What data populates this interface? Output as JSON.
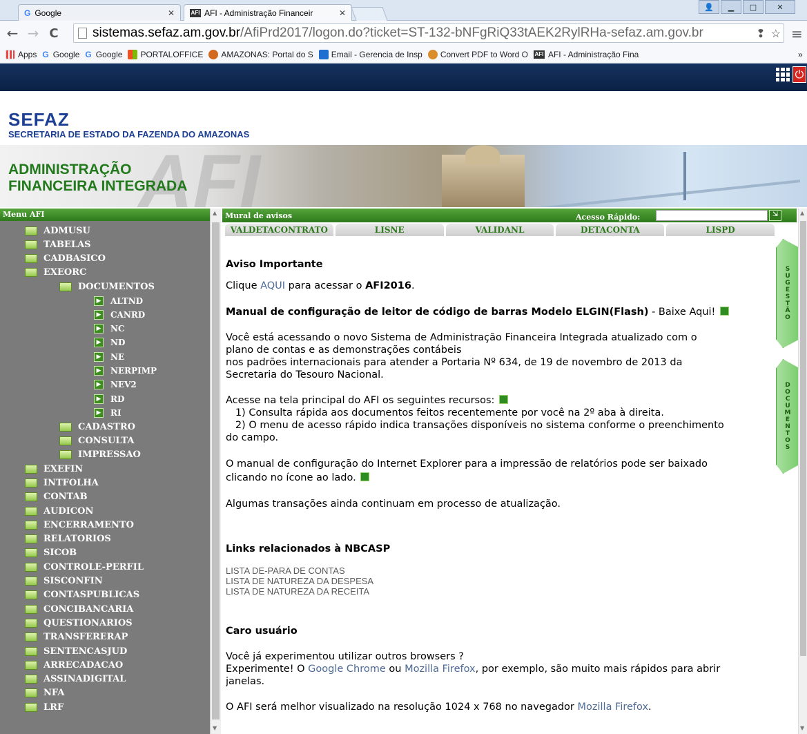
{
  "browser": {
    "tabs": [
      {
        "label": "Google",
        "icon": "google-icon"
      },
      {
        "label": "AFI - Administração Financeir",
        "icon": "afi-icon"
      }
    ],
    "url_host": "sistemas.sefaz.am.gov.br",
    "url_path": "/AfiPrd2017/logon.do?ticket=ST-132-bNFgRiQ33tAEK2RylRHa-sefaz.am.gov.br",
    "bookmarks": [
      "Apps",
      "Google",
      "Google",
      "PORTALOFFICE",
      "AMAZONAS: Portal do S",
      "Email - Gerencia de Insp",
      "Convert PDF to Word O",
      "AFI - Administração Fina"
    ],
    "bookmarks_more": "»"
  },
  "header": {
    "title": "SEFAZ",
    "subtitle": "SECRETARIA DE ESTADO DA FAZENDA DO AMAZONAS",
    "banner_line1": "ADMINISTRAÇÃO",
    "banner_line2": "FINANCEIRA INTEGRADA",
    "banner_watermark": "AFI"
  },
  "menu": {
    "title": "Menu AFI",
    "items": [
      {
        "label": "ADMUSU",
        "level": 0,
        "type": "folder"
      },
      {
        "label": "TABELAS",
        "level": 0,
        "type": "folder"
      },
      {
        "label": "CADBASICO",
        "level": 0,
        "type": "folder"
      },
      {
        "label": "EXEORC",
        "level": 0,
        "type": "folder"
      },
      {
        "label": "DOCUMENTOS",
        "level": 1,
        "type": "folder"
      },
      {
        "label": "ALTND",
        "level": 2,
        "type": "doc"
      },
      {
        "label": "CANRD",
        "level": 2,
        "type": "doc"
      },
      {
        "label": "NC",
        "level": 2,
        "type": "doc"
      },
      {
        "label": "ND",
        "level": 2,
        "type": "doc"
      },
      {
        "label": "NE",
        "level": 2,
        "type": "doc"
      },
      {
        "label": "NERPIMP",
        "level": 2,
        "type": "doc"
      },
      {
        "label": "NEV2",
        "level": 2,
        "type": "doc"
      },
      {
        "label": "RD",
        "level": 2,
        "type": "doc"
      },
      {
        "label": "RI",
        "level": 2,
        "type": "doc"
      },
      {
        "label": "CADASTRO",
        "level": 1,
        "type": "folder"
      },
      {
        "label": "CONSULTA",
        "level": 1,
        "type": "folder"
      },
      {
        "label": "IMPRESSAO",
        "level": 1,
        "type": "folder"
      },
      {
        "label": "EXEFIN",
        "level": 0,
        "type": "folder"
      },
      {
        "label": "INTFOLHA",
        "level": 0,
        "type": "folder"
      },
      {
        "label": "CONTAB",
        "level": 0,
        "type": "folder"
      },
      {
        "label": "AUDICON",
        "level": 0,
        "type": "folder"
      },
      {
        "label": "ENCERRAMENTO",
        "level": 0,
        "type": "folder"
      },
      {
        "label": "RELATORIOS",
        "level": 0,
        "type": "folder"
      },
      {
        "label": "SICOB",
        "level": 0,
        "type": "folder"
      },
      {
        "label": "CONTROLE-PERFIL",
        "level": 0,
        "type": "folder"
      },
      {
        "label": "SISCONFIN",
        "level": 0,
        "type": "folder"
      },
      {
        "label": "CONTASPUBLICAS",
        "level": 0,
        "type": "folder"
      },
      {
        "label": "CONCIBANCARIA",
        "level": 0,
        "type": "folder"
      },
      {
        "label": "QUESTIONARIOS",
        "level": 0,
        "type": "folder"
      },
      {
        "label": "TRANSFERERAP",
        "level": 0,
        "type": "folder"
      },
      {
        "label": "SENTENCASJUD",
        "level": 0,
        "type": "folder"
      },
      {
        "label": "ARRECADACAO",
        "level": 0,
        "type": "folder"
      },
      {
        "label": "ASSINADIGITAL",
        "level": 0,
        "type": "folder"
      },
      {
        "label": "NFA",
        "level": 0,
        "type": "folder"
      },
      {
        "label": "LRF",
        "level": 0,
        "type": "folder"
      }
    ]
  },
  "mural": {
    "title": "Mural de avisos",
    "acesso_label": "Acesso Rápido:",
    "acesso_value": "",
    "quick_tabs": [
      "VALDETACONTRATO",
      "LISNE",
      "VALIDANL",
      "DETACONTA",
      "LISPD"
    ]
  },
  "content": {
    "aviso_title": "Aviso Importante",
    "clique_pre": "Clique ",
    "clique_link": "AQUI",
    "clique_mid": " para acessar o ",
    "clique_bold": "AFI2016",
    "clique_end": ".",
    "manual_bold": "Manual de configuração de leitor de código de barras Modelo ELGIN(Flash)",
    "manual_rest": " - Baixe Aqui!",
    "p1_l1": "Você está acessando o novo Sistema de Administração Financeira Integrada atualizado com o",
    "p1_l2": "plano de contas e as demonstrações contábeis",
    "p1_l3": "nos padrões internacionais para atender a Portaria Nº 634, de 19 de novembro de 2013 da",
    "p1_l4": "Secretaria do Tesouro Nacional.",
    "p2_l1": "Acesse na tela principal do AFI os seguintes recursos:",
    "p2_l2": "   1) Consulta rápida aos documentos feitos recentemente por você na 2º aba à direita.",
    "p2_l3": "   2) O menu de acesso rápido indica transações disponíveis no sistema conforme o preenchimento",
    "p2_l4": "do campo.",
    "p3_l1": "O manual de configuração do Internet Explorer para a impressão de relatórios pode ser baixado",
    "p3_l2": "clicando no ícone ao lado.",
    "p4": "Algumas transações ainda continuam em processo de atualização.",
    "links_title": "Links relacionados à NBCASP",
    "links": [
      "LISTA DE-PARA DE CONTAS",
      "LISTA DE NATUREZA DA DESPESA",
      "LISTA DE NATUREZA DA RECEITA"
    ],
    "caro_title": "Caro usuário",
    "p5_l1": "Você já experimentou utilizar outros browsers ?",
    "p5_pre": "Experimente! O ",
    "p5_chrome": "Google Chrome",
    "p5_mid": " ou ",
    "p5_firefox": "Mozilla Firefox",
    "p5_end": ", por exemplo, são muito mais rápidos para abrir",
    "p5_l3": "janelas.",
    "p6_pre": "O AFI será melhor visualizado na resolução 1024 x 768 no navegador ",
    "p6_link": "Mozilla Firefox",
    "p6_end": "."
  },
  "side_tabs": {
    "sugestao": [
      "S",
      "U",
      "G",
      "E",
      "S",
      "T",
      "Ã",
      "O"
    ],
    "documentos": [
      "D",
      "O",
      "C",
      "U",
      "M",
      "E",
      "N",
      "T",
      "O",
      "S"
    ]
  }
}
